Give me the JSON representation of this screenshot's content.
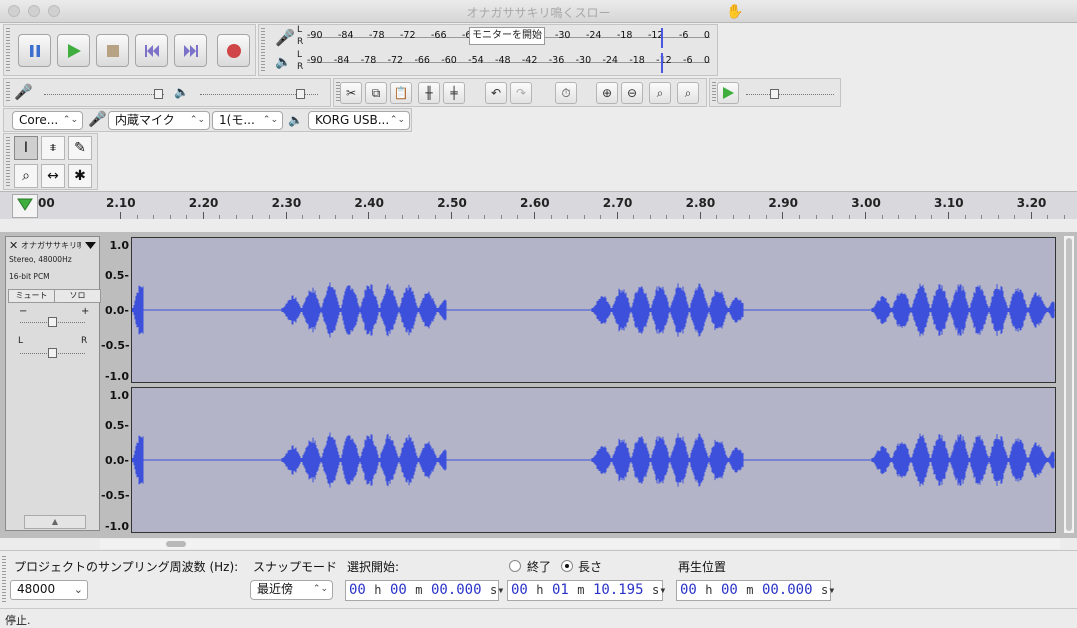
{
  "window": {
    "title": "オナガササキリ鳴くスロー"
  },
  "transport": {
    "buttons": [
      {
        "name": "pause-button",
        "icon": "pause-icon"
      },
      {
        "name": "play-button",
        "icon": "play-icon"
      },
      {
        "name": "stop-button",
        "icon": "stop-icon"
      },
      {
        "name": "skip-start-button",
        "icon": "skip-start-icon"
      },
      {
        "name": "skip-end-button",
        "icon": "skip-end-icon"
      },
      {
        "name": "record-button",
        "icon": "record-icon"
      }
    ]
  },
  "meters": {
    "record_ticks": [
      "-90",
      "-84",
      "-78",
      "-72",
      "-66",
      "-60",
      "",
      "",
      "-36",
      "-30",
      "-24",
      "-18",
      "-12",
      "-6",
      "0"
    ],
    "playback_ticks": [
      "-90",
      "-84",
      "-78",
      "-72",
      "-66",
      "-60",
      "-54",
      "-48",
      "-42",
      "-36",
      "-30",
      "-24",
      "-18",
      "-12",
      "-6",
      "0"
    ],
    "monitor_button": "モニターを開始",
    "channel_L": "L",
    "channel_R": "R"
  },
  "devices": {
    "host": "Core...",
    "input_device": "内蔵マイク",
    "input_channels": "1(モ...",
    "output_device": "KORG USB..."
  },
  "ruler": {
    "labels": [
      "00",
      "2.10",
      "2.20",
      "2.30",
      "2.40",
      "2.50",
      "2.60",
      "2.70",
      "2.80",
      "2.90",
      "3.00",
      "3.10",
      "3.20"
    ]
  },
  "track": {
    "name": "オナガササキリ鳴",
    "info_rate": "Stereo, 48000Hz",
    "info_format": "16-bit PCM",
    "mute_label": "ミュート",
    "solo_label": "ソロ",
    "gain_minus": "−",
    "gain_plus": "+",
    "pan_left": "L",
    "pan_right": "R",
    "scale_labels": [
      "1.0",
      "0.5-",
      "0.0-",
      "-0.5-",
      "-1.0"
    ],
    "waveform_color": "#3c50dc"
  },
  "selection": {
    "rate_label": "プロジェクトのサンプリング周波数 (Hz):",
    "rate_value": "48000",
    "snap_label": "スナップモード",
    "snap_value": "最近傍",
    "start_label": "選択開始:",
    "end_label": "終了",
    "length_label": "長さ",
    "length_selected": true,
    "pos_label": "再生位置",
    "start_time": {
      "h": "00",
      "m": "00",
      "s": "00.000"
    },
    "length_time": {
      "h": "00",
      "m": "01",
      "s": "10.195"
    },
    "pos_time": {
      "h": "00",
      "m": "00",
      "s": "00.000"
    },
    "unit_h": "h",
    "unit_m": "m",
    "unit_s": "s"
  },
  "status": {
    "text": "停止."
  }
}
